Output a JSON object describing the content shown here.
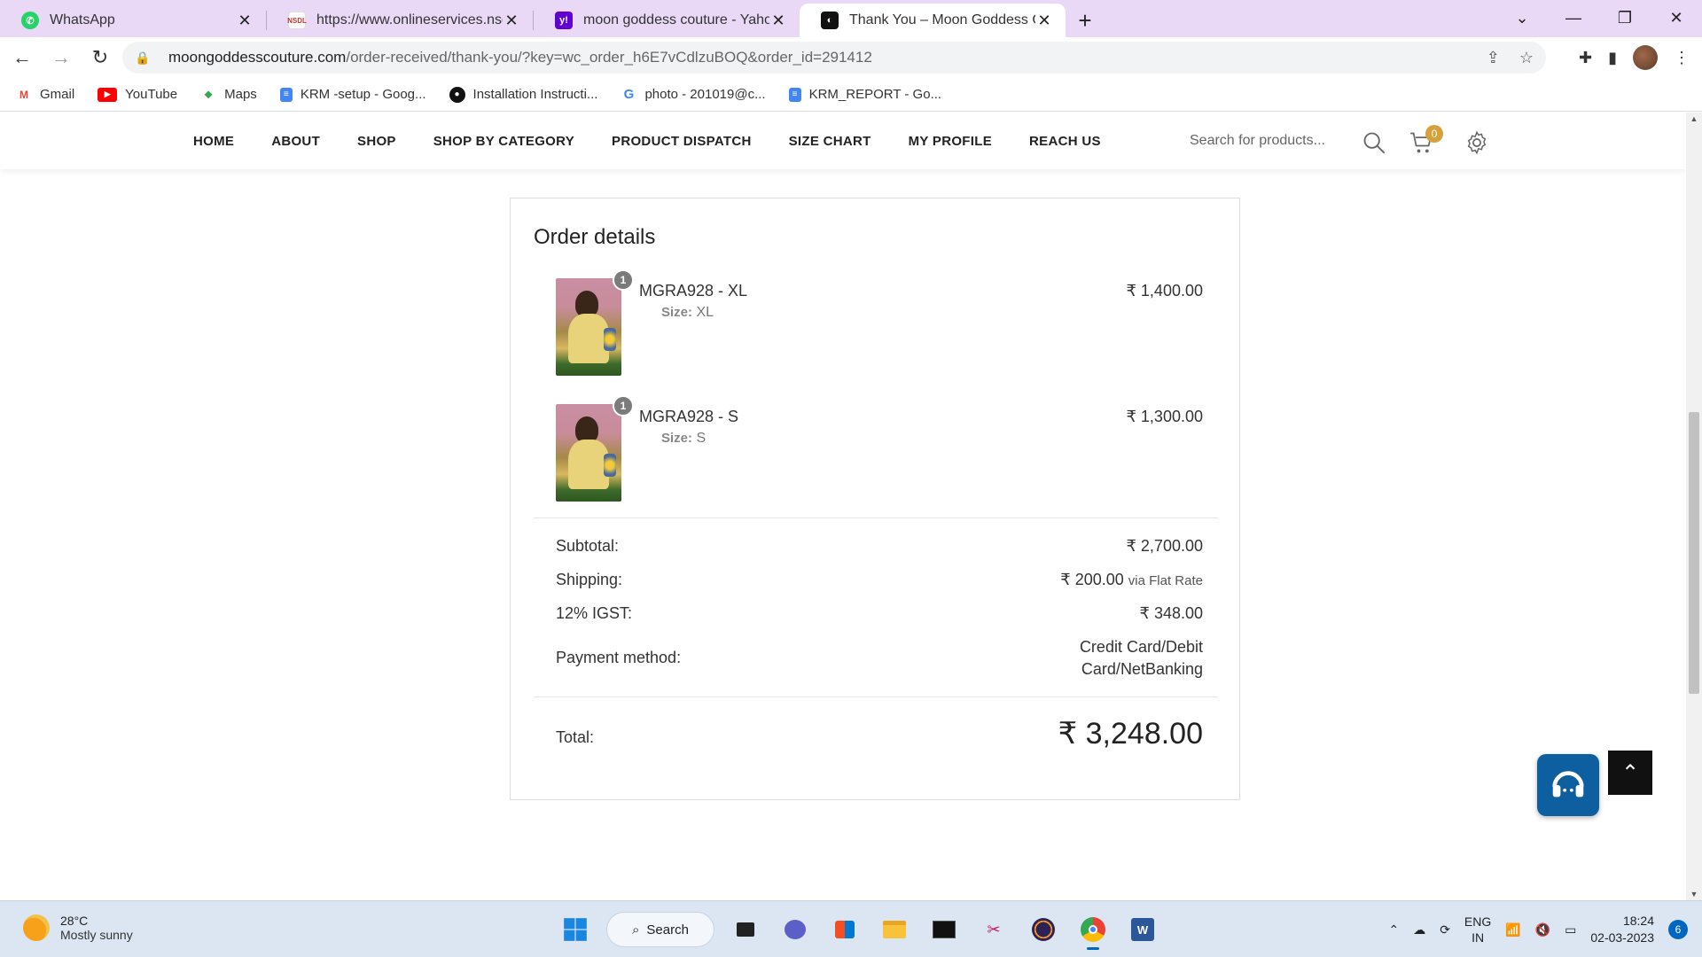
{
  "browser": {
    "tabs": [
      {
        "title": "WhatsApp",
        "icon": "whatsapp-icon",
        "color": "#25d366",
        "active": false
      },
      {
        "title": "https://www.onlineservices.nsdl.c",
        "icon": "nsdl-icon",
        "color": "#c0392b",
        "active": false
      },
      {
        "title": "moon goddess couture - Yahoo I",
        "icon": "yahoo-icon",
        "color": "#6001d2",
        "active": false
      },
      {
        "title": "Thank You – Moon Goddess Cou",
        "icon": "site-icon",
        "color": "#111111",
        "active": true
      }
    ],
    "address": {
      "host": "moongoddesscouture.com",
      "path": "/order-received/thank-you/?key=wc_order_h6E7vCdlzuBOQ&order_id=291412"
    },
    "bookmarks": [
      {
        "label": "Gmail",
        "icon": "gmail-icon"
      },
      {
        "label": "YouTube",
        "icon": "youtube-icon"
      },
      {
        "label": "Maps",
        "icon": "maps-icon"
      },
      {
        "label": "KRM -setup - Goog...",
        "icon": "docs-icon"
      },
      {
        "label": "Installation Instructi...",
        "icon": "github-icon"
      },
      {
        "label": "photo - 201019@c...",
        "icon": "google-icon"
      },
      {
        "label": "KRM_REPORT - Go...",
        "icon": "docs-icon"
      }
    ]
  },
  "site": {
    "nav": [
      "HOME",
      "ABOUT",
      "SHOP",
      "SHOP BY CATEGORY",
      "PRODUCT DISPATCH",
      "SIZE CHART",
      "MY PROFILE",
      "REACH US"
    ],
    "search_placeholder": "Search for products...",
    "cart_count": "0",
    "accent_color": "#d6a13a"
  },
  "order": {
    "heading": "Order details",
    "items": [
      {
        "name": "MGRA928 - XL",
        "qty": "1",
        "size_label": "Size:",
        "size": "XL",
        "price": "₹ 1,400.00"
      },
      {
        "name": "MGRA928 - S",
        "qty": "1",
        "size_label": "Size:",
        "size": "S",
        "price": "₹ 1,300.00"
      }
    ],
    "subtotal_label": "Subtotal:",
    "subtotal": "₹ 2,700.00",
    "shipping_label": "Shipping:",
    "shipping": "₹ 200.00",
    "shipping_via": "via Flat Rate",
    "tax_label": "12% IGST:",
    "tax": "₹ 348.00",
    "payment_label": "Payment method:",
    "payment_line1": "Credit Card/Debit",
    "payment_line2": "Card/NetBanking",
    "total_label": "Total:",
    "total": "₹ 3,248.00"
  },
  "taskbar": {
    "temp": "28°C",
    "weather": "Mostly sunny",
    "search_label": "Search",
    "lang1": "ENG",
    "lang2": "IN",
    "time": "18:24",
    "date": "02-03-2023",
    "notifications": "6"
  }
}
